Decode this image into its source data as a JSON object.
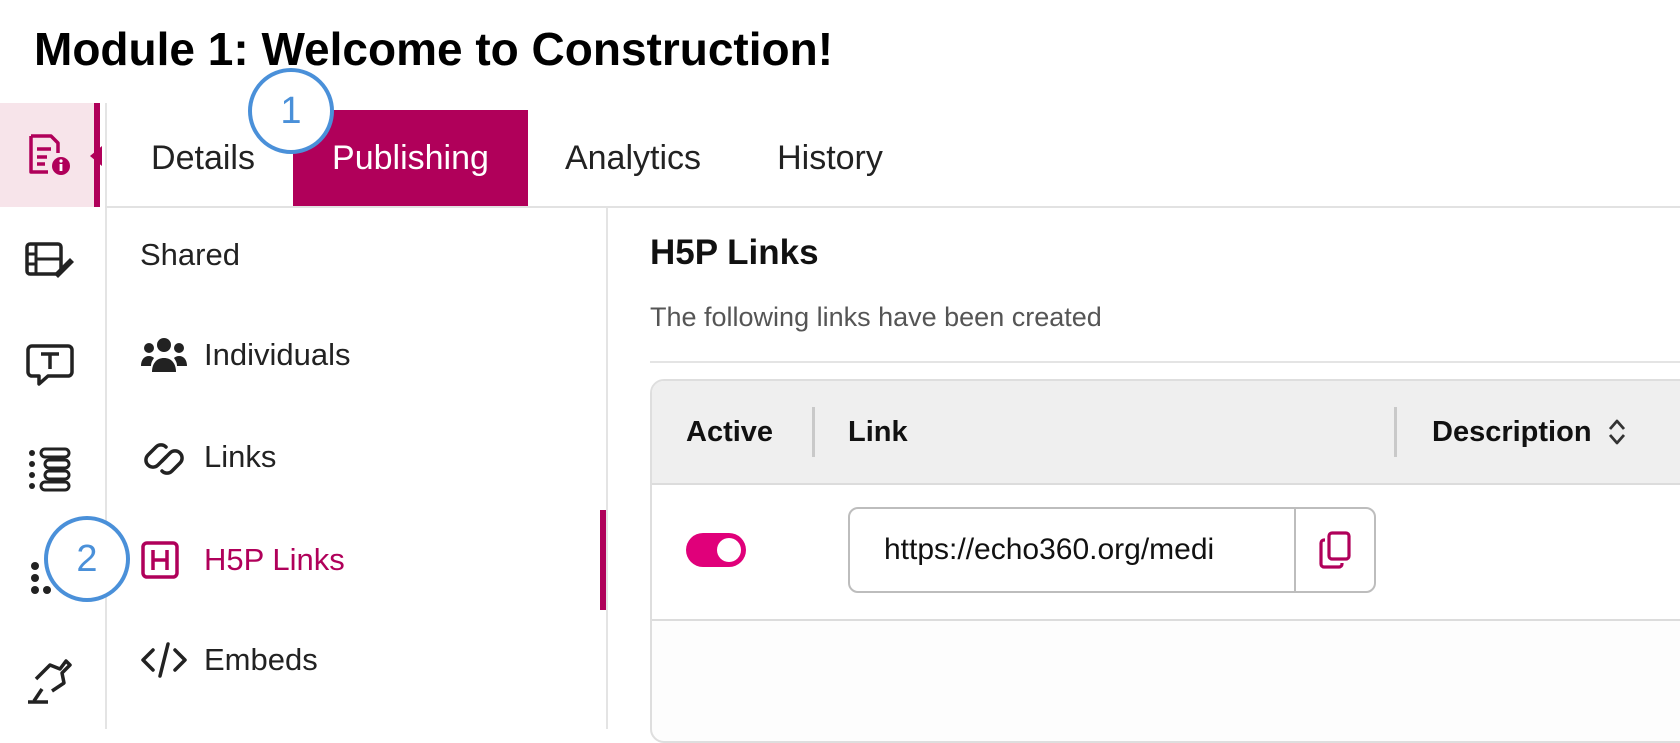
{
  "page": {
    "title": "Module 1: Welcome to Construction!"
  },
  "rail": {
    "icons": [
      "media-info-icon",
      "video-edit-icon",
      "captions-icon",
      "chapters-icon",
      "quiz-icon",
      "interaction-icon"
    ],
    "active_index": 0
  },
  "tabs": [
    {
      "label": "Details",
      "active": false
    },
    {
      "label": "Publishing",
      "active": true
    },
    {
      "label": "Analytics",
      "active": false
    },
    {
      "label": "History",
      "active": false
    }
  ],
  "subnav": {
    "items": [
      {
        "label": "Shared",
        "icon": ""
      },
      {
        "label": "Individuals",
        "icon": "users-icon"
      },
      {
        "label": "Links",
        "icon": "link-icon"
      },
      {
        "label": "H5P Links",
        "icon": "h5p-icon",
        "active": true
      },
      {
        "label": "Embeds",
        "icon": "code-icon"
      }
    ]
  },
  "main": {
    "heading": "H5P Links",
    "subtitle": "The following links have been created",
    "table": {
      "columns": [
        "Active",
        "Link",
        "Description"
      ],
      "rows": [
        {
          "active": true,
          "link": "https://echo360.org/medi",
          "description": ""
        }
      ]
    }
  },
  "callouts": [
    "1",
    "2"
  ],
  "colors": {
    "accent": "#b0005a",
    "toggle": "#e0007a",
    "callout": "#4a90d9"
  }
}
